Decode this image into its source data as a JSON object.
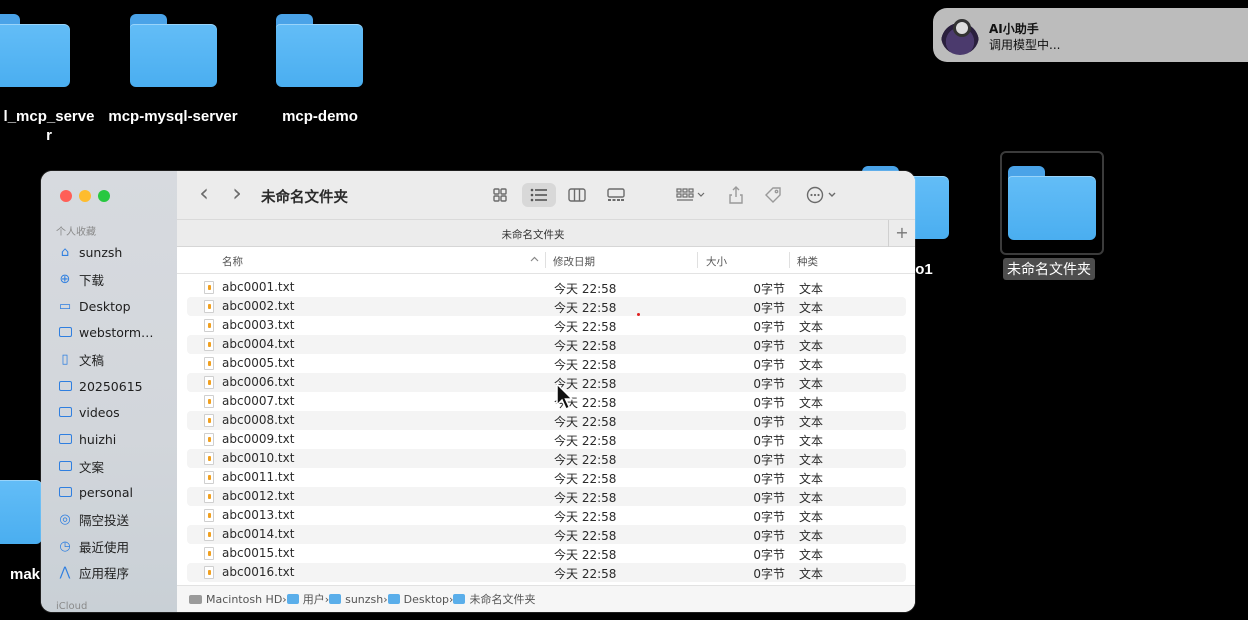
{
  "desktop": {
    "folders": [
      {
        "label": "l_mcp_serve\nr"
      },
      {
        "label": "mcp-mysql-server"
      },
      {
        "label": "mcp-demo"
      },
      {
        "label": "o1"
      },
      {
        "label": "未命名文件夹"
      },
      {
        "label": "mak"
      }
    ]
  },
  "notification": {
    "title": "AI小助手",
    "body": "调用模型中..."
  },
  "window": {
    "title": "未命名文件夹",
    "path_title": "未命名文件夹",
    "toolbar": {
      "back": "‹",
      "forward": "›",
      "plus": "+"
    },
    "sidebar": {
      "favorites_header": "个人收藏",
      "items": [
        {
          "label": "sunzsh",
          "icon": "home-icon"
        },
        {
          "label": "下载",
          "icon": "download-icon"
        },
        {
          "label": "Desktop",
          "icon": "desktop-icon"
        },
        {
          "label": "webstorm…",
          "icon": "folder-icon"
        },
        {
          "label": "文稿",
          "icon": "document-icon"
        },
        {
          "label": "20250615",
          "icon": "folder-icon"
        },
        {
          "label": "videos",
          "icon": "folder-icon"
        },
        {
          "label": "huizhi",
          "icon": "folder-icon"
        },
        {
          "label": "文案",
          "icon": "folder-icon"
        },
        {
          "label": "personal",
          "icon": "folder-icon"
        },
        {
          "label": "隔空投送",
          "icon": "airdrop-icon"
        },
        {
          "label": "最近使用",
          "icon": "clock-icon"
        },
        {
          "label": "应用程序",
          "icon": "apps-icon"
        }
      ],
      "icloud_header": "iCloud"
    },
    "columns": {
      "name": "名称",
      "date": "修改日期",
      "size": "大小",
      "kind": "种类"
    },
    "files": [
      {
        "name": "abc0001.txt",
        "date": "今天 22:58",
        "size": "0字节",
        "kind": "文本"
      },
      {
        "name": "abc0002.txt",
        "date": "今天 22:58",
        "size": "0字节",
        "kind": "文本"
      },
      {
        "name": "abc0003.txt",
        "date": "今天 22:58",
        "size": "0字节",
        "kind": "文本"
      },
      {
        "name": "abc0004.txt",
        "date": "今天 22:58",
        "size": "0字节",
        "kind": "文本"
      },
      {
        "name": "abc0005.txt",
        "date": "今天 22:58",
        "size": "0字节",
        "kind": "文本"
      },
      {
        "name": "abc0006.txt",
        "date": "今天 22:58",
        "size": "0字节",
        "kind": "文本"
      },
      {
        "name": "abc0007.txt",
        "date": "今天 22:58",
        "size": "0字节",
        "kind": "文本"
      },
      {
        "name": "abc0008.txt",
        "date": "今天 22:58",
        "size": "0字节",
        "kind": "文本"
      },
      {
        "name": "abc0009.txt",
        "date": "今天 22:58",
        "size": "0字节",
        "kind": "文本"
      },
      {
        "name": "abc0010.txt",
        "date": "今天 22:58",
        "size": "0字节",
        "kind": "文本"
      },
      {
        "name": "abc0011.txt",
        "date": "今天 22:58",
        "size": "0字节",
        "kind": "文本"
      },
      {
        "name": "abc0012.txt",
        "date": "今天 22:58",
        "size": "0字节",
        "kind": "文本"
      },
      {
        "name": "abc0013.txt",
        "date": "今天 22:58",
        "size": "0字节",
        "kind": "文本"
      },
      {
        "name": "abc0014.txt",
        "date": "今天 22:58",
        "size": "0字节",
        "kind": "文本"
      },
      {
        "name": "abc0015.txt",
        "date": "今天 22:58",
        "size": "0字节",
        "kind": "文本"
      },
      {
        "name": "abc0016.txt",
        "date": "今天 22:58",
        "size": "0字节",
        "kind": "文本"
      }
    ],
    "breadcrumb": [
      "Macintosh HD",
      "用户",
      "sunzsh",
      "Desktop",
      "未命名文件夹"
    ],
    "colors": {
      "close": "#ff5f57",
      "minimize": "#febc2e",
      "zoom": "#28c840",
      "folder": "#5ab4f2"
    }
  }
}
